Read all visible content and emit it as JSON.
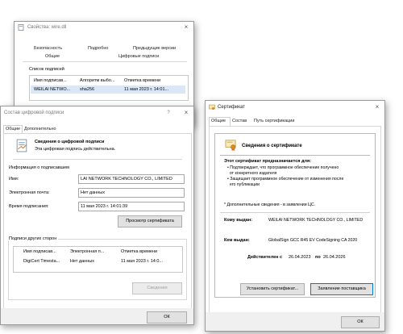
{
  "props_window": {
    "title": "Свойства: wire.dll",
    "close": "×",
    "tabs_row1": [
      "Безопасность",
      "Подробно",
      "Предыдущие версии"
    ],
    "tabs_row2": [
      "Общие",
      "Цифровые подписи"
    ],
    "sig_list_label": "Список подписей",
    "columns": [
      "Имя подписав...",
      "Алгоритм выбо...",
      "Отметка времени"
    ],
    "row": [
      "WEILAI NETWO...",
      "sha256",
      "11 мая 2023 г. 14:01..."
    ]
  },
  "sig_details": {
    "title": "Состав цифровой подписи",
    "help": "?",
    "close": "×",
    "tabs": [
      "Общие",
      "Дополнительно"
    ],
    "info_heading": "Сведения о цифровой подписи",
    "info_text": "Эта цифровая подпись действительна.",
    "signer_group": "Информация о подписавшем",
    "name_label": "Имя:",
    "name_value": "LAI NETWORK TECHNOLOGY CO., LIMITED",
    "email_label": "Электронная почта:",
    "email_value": "Нет данных",
    "time_label": "Время подписания:",
    "time_value": "11 мая 2023 г. 14:01:39",
    "view_cert_button": "Просмотр сертификата",
    "countersig_group": "Подписи других сторон",
    "cs_columns": [
      "Имя подписав...",
      "Электронная п...",
      "Отметка времени"
    ],
    "cs_row": [
      "DigiCert Timesta...",
      "Нет данных",
      "11 мая 2023 г. 14:0..."
    ],
    "details_button": "Сведения",
    "ok_button": "ОК"
  },
  "cert_window": {
    "title": "Сертификат",
    "close": "×",
    "tabs": [
      "Общие",
      "Состав",
      "Путь сертификации"
    ],
    "heading": "Сведения о сертификате",
    "purpose_heading": "Этот сертификат предназначается для:",
    "purposes": [
      "• Подтверждает, что программное обеспечение получено",
      "  от конкретного издателя",
      "• Защищает программное обеспечение от изменения после",
      "  его публикации"
    ],
    "extra_note": "* Дополнительные сведения - в заявлении ЦС.",
    "issued_to_label": "Кому выдан:",
    "issued_to_value": "WEILAI NETWORK TECHNOLOGY CO., LIMITED",
    "issued_by_label": "Кем выдан:",
    "issued_by_value": "GlobalSign GCC R45 EV CodeSigning CA 2020",
    "valid_label": "Действителен с",
    "valid_from": "26.04.2023",
    "valid_by": "по",
    "valid_to": "26.04.2026",
    "install_button": "Установить сертификат...",
    "statement_button": "Заявление поставщика",
    "ok_button": "ОК"
  }
}
